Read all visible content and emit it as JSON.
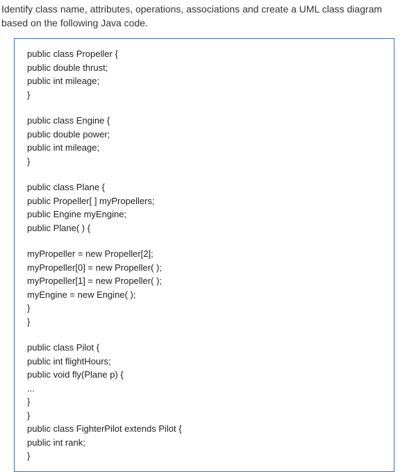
{
  "header": {
    "text": "Identify class name, attributes, operations, associations and create a UML class diagram based on the following Java code."
  },
  "code": {
    "lines": [
      "public class Propeller {",
      "public double thrust;",
      "public int mileage;",
      "}",
      "",
      "public class Engine {",
      "public double power;",
      "public int mileage;",
      "}",
      "",
      "public class Plane {",
      "public Propeller[ ] myPropellers;",
      "public Engine myEngine;",
      "public Plane( ) {",
      "",
      "myPropeller = new Propeller[2];",
      "myPropeller[0] = new Propeller( );",
      "myPropeller[1] = new Propeller( );",
      "myEngine = new Engine( );",
      "}",
      "}",
      "",
      "public class Pilot {",
      "public int flightHours;",
      "public void fly(Plane p) {",
      "...",
      "}",
      "}",
      "public class FighterPilot extends Pilot {",
      "public int rank;",
      "}"
    ]
  }
}
